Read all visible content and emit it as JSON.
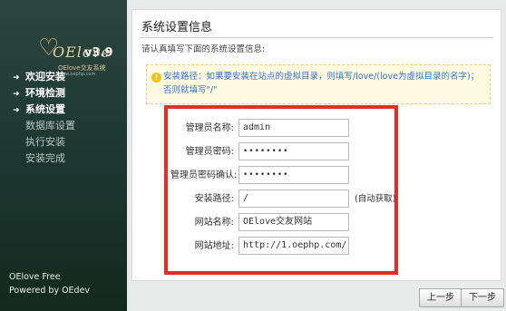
{
  "sidebar": {
    "logo_text": "OElove",
    "logo_sub": "OElove交友系统",
    "logo_sub2": "www.oephp.com",
    "version": "v3.9",
    "steps": [
      {
        "label": "欢迎安装",
        "state": "done"
      },
      {
        "label": "环境检测",
        "state": "done"
      },
      {
        "label": "系统设置",
        "state": "done"
      },
      {
        "label": "数据库设置",
        "state": "pending"
      },
      {
        "label": "执行安装",
        "state": "pending"
      },
      {
        "label": "安装完成",
        "state": "pending"
      }
    ],
    "footer_line1": "OElove Free",
    "footer_line2": "Powered by OEdev"
  },
  "main": {
    "title": "系统设置信息",
    "subtitle": "请认真填写下面的系统设置信息:",
    "notice": "安装路径：如果要安装在站点的虚拟目录，则填写/love/(love为虚拟目录的名字)；否则就填写\"/\"",
    "notice_icon": "lightbulb-icon",
    "form": {
      "admin_name_label": "管理员名称:",
      "admin_name_value": "admin",
      "admin_pwd_label": "管理员密码:",
      "admin_pwd_value": "••••••••",
      "admin_pwd2_label": "管理员密码确认:",
      "admin_pwd2_value": "••••••••",
      "path_label": "安装路径:",
      "path_value": "/",
      "path_hint": "(自动获取)",
      "site_name_label": "网站名称:",
      "site_name_value": "OElove交友网站",
      "site_url_label": "网站地址:",
      "site_url_value": "http://1.oephp.com/"
    },
    "prev_button": "上一步",
    "next_button": "下一步"
  },
  "colors": {
    "sidebar_bg": "#1f3933",
    "highlight_border": "#e62b2b",
    "notice_text": "#3472c3"
  }
}
